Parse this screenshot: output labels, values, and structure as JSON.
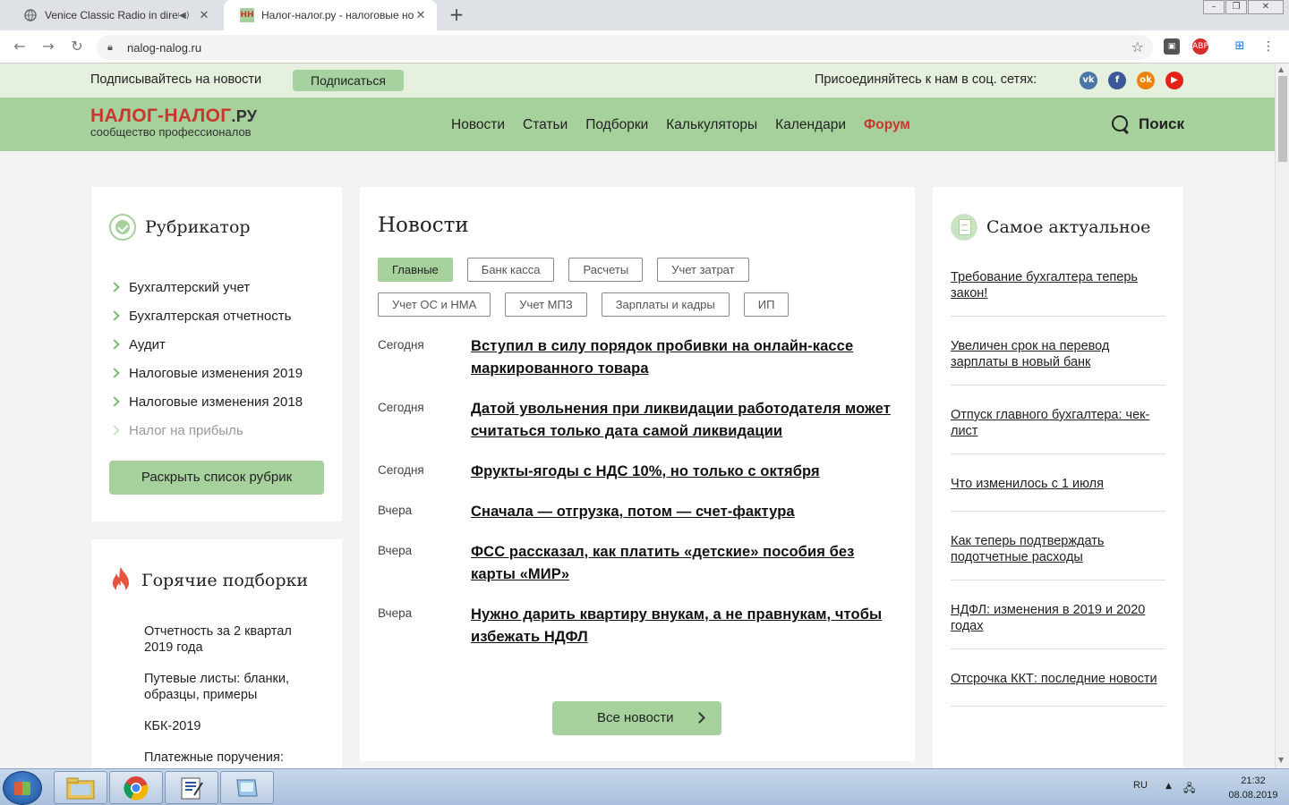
{
  "browser": {
    "tabs": [
      {
        "title": "Venice Classic Radio in diretta",
        "favicon": "globe-icon",
        "active": false,
        "audio": true
      },
      {
        "title": "Налог-налог.ру - налоговые новости",
        "favicon": "НН",
        "active": true,
        "audio": false
      }
    ],
    "new_tab_label": "+",
    "url": "nalog-nalog.ru",
    "extensions": [
      "ABP"
    ]
  },
  "site": {
    "subscribe_text": "Подписывайтесь на новости",
    "subscribe_button": "Подписаться",
    "social_text": "Присоединяйтесь к нам в соц. сетях:",
    "social_icons": [
      {
        "name": "vk-icon",
        "label": "vk",
        "color": "#4a76a8"
      },
      {
        "name": "facebook-icon",
        "label": "f",
        "color": "#3b5998"
      },
      {
        "name": "odnoklassniki-icon",
        "label": "ok",
        "color": "#ee8208"
      },
      {
        "name": "youtube-icon",
        "label": "▶",
        "color": "#e62117"
      }
    ],
    "logo_main": "НАЛОГ-НАЛОГ",
    "logo_tld": ".РУ",
    "logo_tagline": "сообщество профессионалов",
    "menu": [
      "Новости",
      "Статьи",
      "Подборки",
      "Калькуляторы",
      "Календари",
      "Форум"
    ],
    "search_label": "Поиск",
    "accent_green": "#a6d19d",
    "accent_red": "#c8372d"
  },
  "rubricator": {
    "title": "Рубрикатор",
    "items": [
      "Бухгалтерский учет",
      "Бухгалтерская отчетность",
      "Аудит",
      "Налоговые изменения 2019",
      "Налоговые изменения 2018",
      "Налог на прибыль"
    ],
    "expand_button": "Раскрыть список рубрик"
  },
  "hot": {
    "title": "Горячие подборки",
    "items": [
      "Отчетность за 2 квартал 2019 года",
      "Путевые листы: бланки, образцы, примеры",
      "КБК-2019",
      "Платежные поручения:"
    ]
  },
  "news": {
    "title": "Новости",
    "tags_row1": [
      "Главные",
      "Банк касса",
      "Расчеты",
      "Учет затрат"
    ],
    "tags_row2": [
      "Учет ОС и НМА",
      "Учет МПЗ",
      "Зарплаты и кадры",
      "ИП"
    ],
    "items": [
      {
        "date": "Сегодня",
        "title": "Вступил в силу порядок пробивки на онлайн-кассе маркированного товара"
      },
      {
        "date": "Сегодня",
        "title": "Датой увольнения при ликвидации работодателя может считаться только дата самой ликвидации"
      },
      {
        "date": "Сегодня",
        "title": "Фрукты-ягоды с НДС 10%, но только с октября"
      },
      {
        "date": "Вчера",
        "title": "Сначала — отгрузка, потом — счет-фактура"
      },
      {
        "date": "Вчера",
        "title": "ФСС рассказал, как платить «детские» пособия без карты «МИР»"
      },
      {
        "date": "Вчера",
        "title": "Нужно дарить квартиру внукам, а не правнукам, чтобы избежать НДФЛ"
      }
    ],
    "all_button": "Все новости"
  },
  "actual": {
    "title": "Самое актуальное",
    "items": [
      "Требование бухгалтера теперь закон!",
      "Увеличен срок на перевод зарплаты в новый банк",
      "Отпуск главного бухгалтера: чек-лист",
      "Что изменилось с 1 июля",
      "Как теперь подтверждать подотчетные расходы",
      "НДФЛ: изменения в 2019 и 2020 годах",
      "Отсрочка ККТ: последние новости"
    ]
  },
  "taskbar": {
    "lang": "RU",
    "time": "21:32",
    "date": "08.08.2019"
  }
}
